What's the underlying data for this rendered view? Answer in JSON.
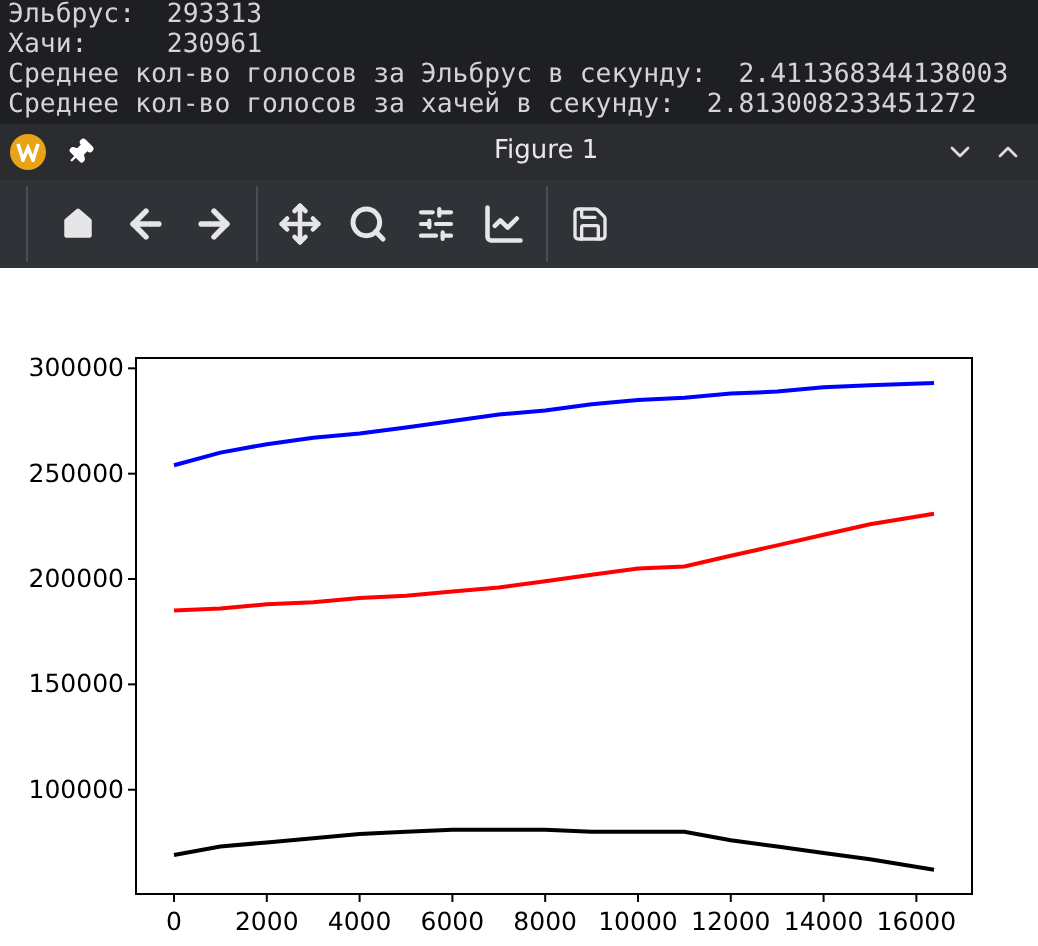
{
  "terminal": {
    "lines": [
      "Эльбрус:  293313",
      "Хачи:     230961",
      "Среднее кол-во голосов за Эльбрус в секунду:  2.411368344138003",
      "Среднее кол-во голосов за хачей в секунду:  2.813008233451272"
    ]
  },
  "window": {
    "title": "Figure 1"
  },
  "figure": {
    "chart_data": {
      "type": "line",
      "x": [
        0,
        1000,
        2000,
        3000,
        4000,
        5000,
        6000,
        7000,
        8000,
        9000,
        10000,
        11000,
        12000,
        13000,
        14000,
        15000,
        16380
      ],
      "xlim": [
        -819,
        17199
      ],
      "ylim": [
        50500,
        304900
      ],
      "xticks": [
        0,
        2000,
        4000,
        6000,
        8000,
        10000,
        12000,
        14000,
        16000
      ],
      "yticks": [
        100000,
        150000,
        200000,
        250000,
        300000
      ],
      "series": [
        {
          "color": "#0000ff",
          "values": [
            254000,
            260000,
            264000,
            267000,
            269000,
            272000,
            275000,
            278000,
            280000,
            283000,
            285000,
            286000,
            288000,
            289000,
            291000,
            292000,
            293000
          ]
        },
        {
          "color": "#ff0000",
          "values": [
            185000,
            186000,
            188000,
            189000,
            191000,
            192000,
            194000,
            196000,
            199000,
            202000,
            205000,
            206000,
            211000,
            216000,
            221000,
            226000,
            231000
          ]
        },
        {
          "color": "#000000",
          "values": [
            69000,
            73000,
            75000,
            77000,
            79000,
            80000,
            81000,
            81000,
            81000,
            80000,
            80000,
            80000,
            76000,
            73000,
            70000,
            67000,
            62000
          ]
        }
      ]
    }
  }
}
